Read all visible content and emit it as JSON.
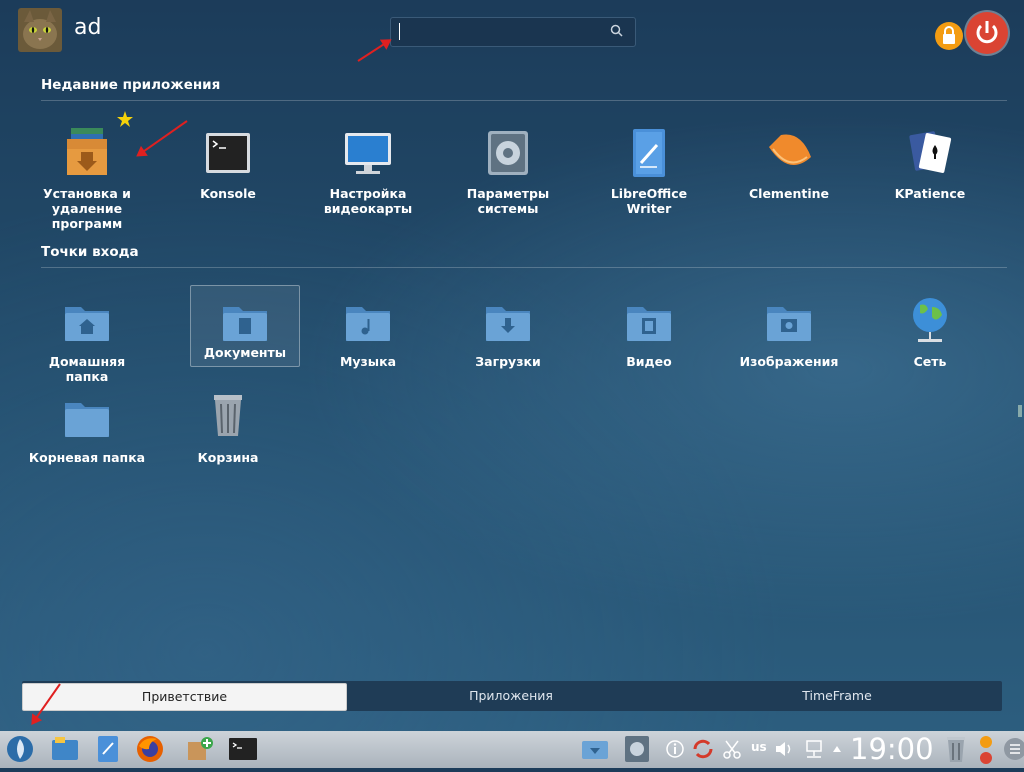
{
  "user": {
    "name": "ad"
  },
  "search": {
    "placeholder": ""
  },
  "sections": {
    "recent": {
      "title": "Недавние приложения"
    },
    "places": {
      "title": "Точки входа"
    }
  },
  "recent_apps": [
    {
      "label": "Установка и удаление программ",
      "icon": "package-installer-icon"
    },
    {
      "label": "Konsole",
      "icon": "terminal-icon"
    },
    {
      "label": "Настройка видеокарты",
      "icon": "monitor-icon"
    },
    {
      "label": "Параметры системы",
      "icon": "system-settings-icon"
    },
    {
      "label": "LibreOffice Writer",
      "icon": "writer-icon"
    },
    {
      "label": "Clementine",
      "icon": "clementine-icon"
    },
    {
      "label": "KPatience",
      "icon": "card-game-icon"
    }
  ],
  "places": [
    {
      "label": "Домашняя папка",
      "icon": "home-folder-icon"
    },
    {
      "label": "Документы",
      "icon": "documents-folder-icon"
    },
    {
      "label": "Музыка",
      "icon": "music-folder-icon"
    },
    {
      "label": "Загрузки",
      "icon": "downloads-folder-icon"
    },
    {
      "label": "Видео",
      "icon": "video-folder-icon"
    },
    {
      "label": "Изображения",
      "icon": "pictures-folder-icon"
    },
    {
      "label": "Сеть",
      "icon": "network-globe-icon"
    },
    {
      "label": "Корневая папка",
      "icon": "root-folder-icon"
    },
    {
      "label": "Корзина",
      "icon": "trash-icon"
    }
  ],
  "tabs": [
    {
      "label": "Приветствие",
      "active": true
    },
    {
      "label": "Приложения",
      "active": false
    },
    {
      "label": "TimeFrame",
      "active": false
    }
  ],
  "taskbar": {
    "clock": "19:00",
    "keyboard_layout": "us"
  },
  "colors": {
    "accent_red": "#e02020",
    "power": "#da4433",
    "lock": "#f39c12",
    "folder": "#6aa3d6"
  }
}
